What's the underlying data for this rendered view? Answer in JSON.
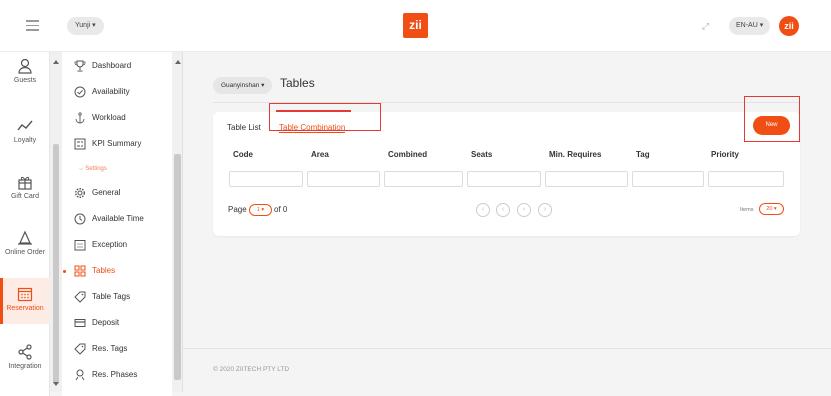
{
  "topbar": {
    "user": "Yunji",
    "logo_text": "zii",
    "language": "EN-AU",
    "avatar_text": "zii"
  },
  "primary_nav": [
    {
      "label": "Guests",
      "icon": "user-icon"
    },
    {
      "label": "Loyalty",
      "icon": "trend-icon"
    },
    {
      "label": "Gift Card",
      "icon": "gift-icon"
    },
    {
      "label": "Online Order",
      "icon": "bell-icon"
    },
    {
      "label": "Reservation",
      "icon": "calendar-icon",
      "active": true
    },
    {
      "label": "Integration",
      "icon": "share-icon"
    }
  ],
  "secondary_nav": {
    "items_top": [
      {
        "label": "Dashboard",
        "icon": "trophy-icon"
      },
      {
        "label": "Availability",
        "icon": "check-circle-icon"
      },
      {
        "label": "Workload",
        "icon": "anchor-icon"
      },
      {
        "label": "KPI Summary",
        "icon": "kpi-icon"
      }
    ],
    "section": "Settings",
    "items_settings": [
      {
        "label": "General",
        "icon": "gear-icon"
      },
      {
        "label": "Available Time",
        "icon": "clock-icon"
      },
      {
        "label": "Exception",
        "icon": "calendar-grid-icon"
      },
      {
        "label": "Tables",
        "icon": "tables-grid-icon",
        "active": true
      },
      {
        "label": "Table Tags",
        "icon": "tag-icon"
      },
      {
        "label": "Deposit",
        "icon": "card-icon"
      },
      {
        "label": "Res. Tags",
        "icon": "tag-icon"
      },
      {
        "label": "Res. Phases",
        "icon": "phases-icon"
      }
    ]
  },
  "main": {
    "store": "Guanyinshan",
    "title": "Tables",
    "tabs": [
      "Table List",
      "Table Combination"
    ],
    "new_button": "New",
    "columns": [
      "Code",
      "Area",
      "Combined",
      "Seats",
      "Min. Requires",
      "Tag",
      "Priority"
    ],
    "pagination": {
      "page_label": "Page",
      "page_value": "1",
      "of_text": "of 0",
      "items_label": "Items",
      "items_value": "20"
    },
    "footer": "© 2020 ZIITECH PTY LTD"
  },
  "colors": {
    "accent": "#f04e14",
    "annotation": "#e53935"
  }
}
